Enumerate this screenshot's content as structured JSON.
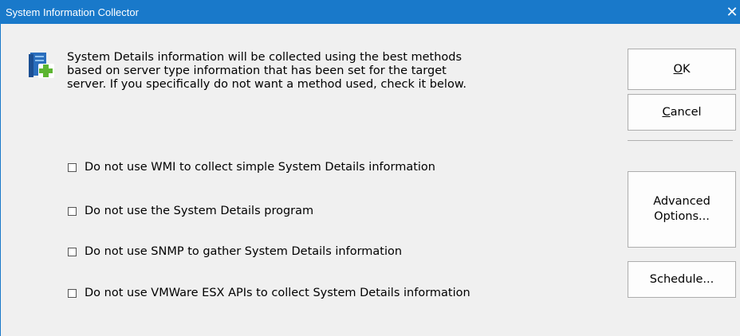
{
  "window": {
    "title": "System Information Collector",
    "close_glyph": "✕",
    "title_bar_color": "#1979ca"
  },
  "header": {
    "icon": "server-details-add-icon",
    "description_line1": "System Details information will be collected using the best methods",
    "description_line2": "based on server type information that has been set for the target",
    "description_line3": "server.  If you specifically do not want a method used, check it below."
  },
  "options": [
    {
      "label": "Do not use WMI to collect simple System Details information",
      "checked": false
    },
    {
      "label": "Do not use the System Details program",
      "checked": false
    },
    {
      "label": "Do not use SNMP to gather System Details information",
      "checked": false
    },
    {
      "label": "Do not use VMWare ESX APIs to collect System Details information",
      "checked": false
    }
  ],
  "buttons": {
    "ok_mnemonic": "O",
    "ok_rest": "K",
    "cancel_mnemonic": "C",
    "cancel_rest": "ancel",
    "advanced_line1": "Advanced",
    "advanced_line2": "Options...",
    "schedule": "Schedule..."
  }
}
